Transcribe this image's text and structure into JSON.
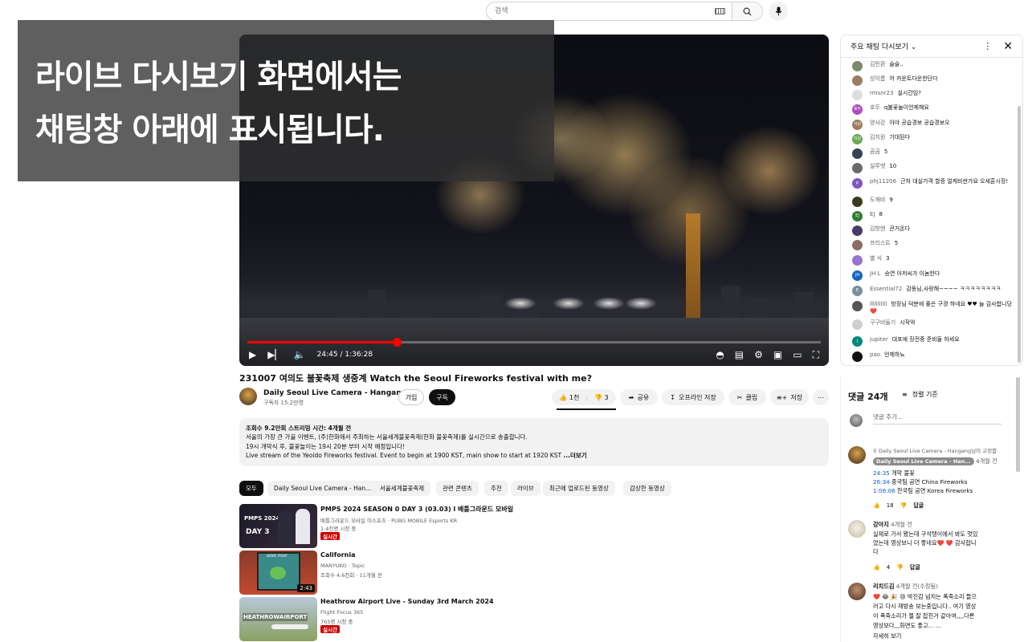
{
  "search": {
    "placeholder": "검색"
  },
  "overlay": {
    "line1": "라이브 다시보기 화면에서는",
    "line2": "채팅창 아래에 표시됩니다."
  },
  "player": {
    "time": "24:45 / 1:36:28",
    "progress": 0.26
  },
  "video": {
    "title": "231007 여의도 불꽃축제 생중계 Watch the Seoul Fireworks festival with me?"
  },
  "channel": {
    "name": "Daily Seoul Live Camera - Hangang",
    "subscribers": "구독자 15.2만명",
    "join": "가입",
    "subscribe": "구독"
  },
  "actions": {
    "likes": "1천",
    "dislikes": "3",
    "share": "공유",
    "offline": "오프라인 저장",
    "clip": "클립",
    "save": "저장"
  },
  "description": {
    "stats": "조회수 9.2만회  스트리밍 시간: 4개월 전",
    "line1": "서울의 가장 큰 가을 이벤트, (주)한화에서 주최하는 서울세계불꽃축제(한화 불꽃축제)를 실시간으로 송출합니다.",
    "line2": "19시 개막식 후, 불꽃놀이는 19시 20분 부터 시작 예정입니다!",
    "line3": "Live stream of the Yeoido Fireworks festival. Event to begin at 1900 KST, main show to start at 1920 KST",
    "more": "...더보기"
  },
  "chips": [
    "모두",
    "Daily Seoul Live Camera - Han...",
    "서울세계불꽃축제",
    "관련 콘텐츠",
    "추천",
    "라이브",
    "최근에 업로드된 동영상",
    "감상한 동영상"
  ],
  "related": [
    {
      "title": "PMPS 2024 SEASON 0 DAY 3 (03.03) l 배틀그라운드 모바일",
      "channel": "배틀그라운드 모바일 이스포츠 · PUBG MOBILE Esports KR",
      "meta": "1.4천명 시청 중",
      "badge": "실시간",
      "thumb_text": "PMPS 2024",
      "thumb_sub": "DAY 3"
    },
    {
      "title": "California",
      "channel": "MANYUKO · Topic",
      "meta": "조회수 4.6천회 · 11개월 전",
      "duration": "2:43",
      "thumb_text": "GENIC FIGHT"
    },
    {
      "title": "Heathrow Airport Live - Sunday 3rd March 2024",
      "channel": "Flight Focus 365",
      "meta": "765명 시청 중",
      "badge": "실시간",
      "thumb_text": "HEATHROWAIRPORT"
    }
  ],
  "chat": {
    "title": "주요 채팅 다시보기",
    "messages": [
      {
        "author": "김민환",
        "text": "슬슬..",
        "color": "#7a8a6a"
      },
      {
        "author": "성이름",
        "text": "어 카운트다운한단다",
        "color": "#9c7e63"
      },
      {
        "author": "rmsnr23",
        "text": "실시간임?",
        "color": "#dcdcdc"
      },
      {
        "author": "호두",
        "text": "q불꽃놀이언제해요",
        "color": "#b04ac0",
        "initial": "호두"
      },
      {
        "author": "양사강",
        "text": "아야 공습경보 공습경보오",
        "color": "#a07a5a",
        "initial": "사강"
      },
      {
        "author": "김지원",
        "text": "기대된다",
        "color": "#6aa84f",
        "initial": "지원"
      },
      {
        "author": "곰곰",
        "text": "5",
        "color": "#334455"
      },
      {
        "author": "실루엣",
        "text": "10",
        "color": "#6a6a6a"
      },
      {
        "author": "phj11206",
        "text": "근처 대실가격 할증 얼케비싼가요 오세훈시장!",
        "color": "#7e57c2",
        "initial": "p"
      },
      {
        "author": "도깨비",
        "text": "9",
        "color": "#3a3a20"
      },
      {
        "author": "EJ",
        "text": "8",
        "color": "#2e7d32",
        "initial": "EJ"
      },
      {
        "author": "김방앤",
        "text": "큰거온다",
        "color": "#4a3a6a"
      },
      {
        "author": "프리스트",
        "text": "5",
        "color": "#8d6e63"
      },
      {
        "author": "별 식",
        "text": "3",
        "color": "#9575cd"
      },
      {
        "author": "JH L",
        "text": "승연 아저씨가 이놈한다",
        "color": "#1565c0",
        "initial": "JH"
      },
      {
        "author": "Essential72",
        "text": "감동님,사랑해~~~~ ㅋㅋㅋㅋㅋㅋㅋㅋ",
        "color": "#78909c",
        "initial": "E"
      },
      {
        "author": "lllllllllll",
        "text": "방장님 덕분에 좋은 구경 하네요 ♥♥ 늘 감사합니당❤️",
        "color": "#555555"
      },
      {
        "author": "구구비들기",
        "text": "시작악",
        "color": "#cfcfcf"
      },
      {
        "author": "jupiter",
        "text": "대포에 장전중 준비들 하세요",
        "color": "#00897b",
        "initial": "j"
      },
      {
        "author": "pao",
        "text": "언제하뇨",
        "color": "#111111"
      }
    ]
  },
  "comments": {
    "count": "댓글 24개",
    "sort": "정렬 기준",
    "add_placeholder": "댓글 추가...",
    "items": [
      {
        "pinned": "Daily Seoul Live Camera - Hangang님이 고정함",
        "author": "Daily Seoul Live Camera - Han...",
        "time": "4개월 전",
        "lines": [
          {
            "ts": "24:35",
            "text": "개막 불꽃"
          },
          {
            "ts": "26:34",
            "text": "중국팀 공연 China Fireworks"
          },
          {
            "ts": "1:08:06",
            "text": "한국팀 공연 Korea Fireworks"
          }
        ],
        "likes": "18",
        "reply": "답글"
      },
      {
        "author": "강아지",
        "time": "4개월 전",
        "lines": [
          {
            "text": "실제로 가서 봤는데 구석탱이에서 봐도 멋있"
          },
          {
            "text": "었는데 영상보니 더 좋네요❤️ ❤️ 감사합니"
          },
          {
            "text": "다"
          }
        ],
        "likes": "4",
        "reply": "답글"
      },
      {
        "author": "리치드김",
        "time": "4개월 전(수정됨)",
        "lines": [
          {
            "text": "❤️ 😂 🎉 😢 박진감 넘치는 폭죽소리 들으"
          },
          {
            "text": "러고 다시 재방송 보는중입니다.. 여기 영상"
          },
          {
            "text": "이 폭죽소리가 젤 잘 잡힌거 같아여,,,,다른"
          },
          {
            "text": "영상보다,,,화면도 좋고... ..."
          }
        ],
        "more": "자세히 보기"
      }
    ]
  }
}
